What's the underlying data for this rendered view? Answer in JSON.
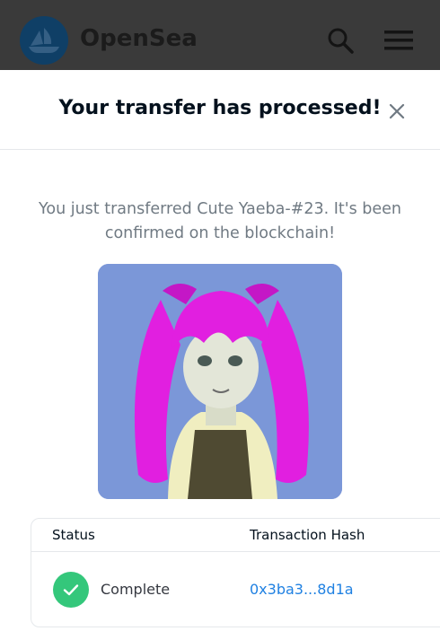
{
  "header": {
    "brand": "OpenSea",
    "icons": {
      "logo": "opensea-logo-icon",
      "search": "search-icon",
      "menu": "menu-icon"
    }
  },
  "modal": {
    "title": "Your transfer has processed!",
    "close_icon": "close-icon",
    "message": "You just transferred Cute Yaeba-#23. It's been confirmed on the blockchain!",
    "image_alt": "Cute Yaeba-#23",
    "table": {
      "headers": {
        "status": "Status",
        "hash": "Transaction Hash"
      },
      "row": {
        "status": "Complete",
        "hash": "0x3ba3...8d1a"
      }
    }
  },
  "colors": {
    "header_bg": "#3a3a3a",
    "accent_link": "#2081e2",
    "success": "#34c77b",
    "text_muted": "#707a83"
  }
}
